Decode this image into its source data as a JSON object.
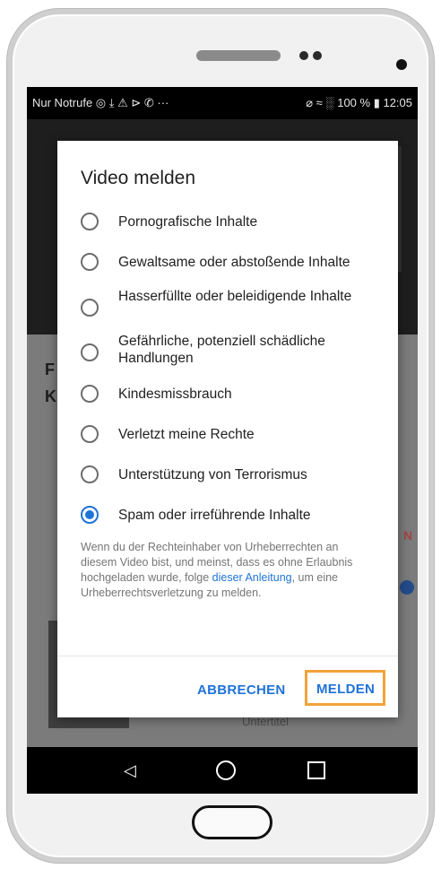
{
  "status_bar": {
    "left_text": "Nur Notrufe ◎ ⤓ ⚠ ⊳ ✆ ···",
    "right_text": "⌀ ≈ ░ 100 % ▮ 12:05"
  },
  "background": {
    "title_fragment": "F\nK",
    "red_fragment": "N",
    "sub_fragment": "Untertitel"
  },
  "dialog": {
    "title": "Video melden",
    "options": [
      {
        "label": "Pornografische Inhalte",
        "selected": false
      },
      {
        "label": "Gewaltsame oder abstoßende Inhalte",
        "selected": false
      },
      {
        "label": "Hasserfüllte oder beleidigende Inhalte",
        "selected": false
      },
      {
        "label": "Gefährliche, potenziell schädliche Handlungen",
        "selected": false
      },
      {
        "label": "Kindesmissbrauch",
        "selected": false
      },
      {
        "label": "Verletzt meine Rechte",
        "selected": false
      },
      {
        "label": "Unterstützung von Terrorismus",
        "selected": false
      },
      {
        "label": "Spam oder irreführende Inhalte",
        "selected": true
      }
    ],
    "note": {
      "text_before": "Wenn du der Rechteinhaber von Urheberrechten an diesem Video bist, und meinst, dass es ohne Erlaubnis hochgeladen wurde, folge ",
      "link": "dieser Anleitung",
      "text_after": ", um eine Urheberrechtsverletzung zu melden."
    },
    "cancel_label": "ABBRECHEN",
    "report_label": "MELDEN"
  },
  "colors": {
    "accent": "#1f73d8",
    "highlight": "#f1a33a"
  },
  "nav": {
    "back": "◁"
  }
}
